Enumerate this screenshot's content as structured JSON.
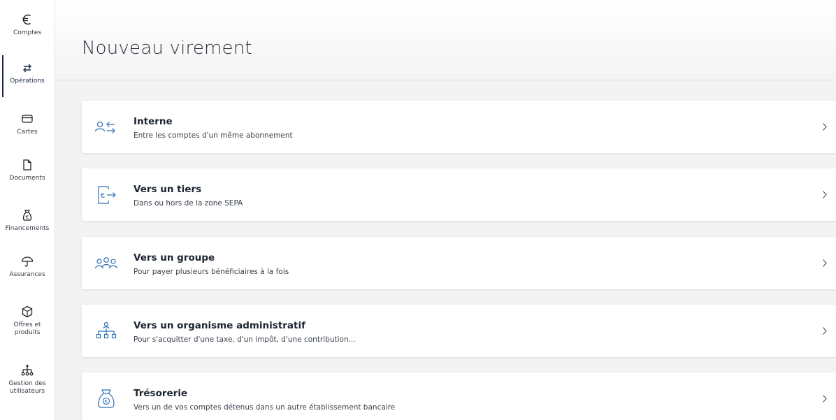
{
  "sidebar": {
    "items": [
      {
        "label": "Comptes",
        "icon": "euro-icon"
      },
      {
        "label": "Opérations",
        "icon": "transfer-arrows-icon",
        "active": true
      },
      {
        "label": "Cartes",
        "icon": "card-icon"
      },
      {
        "label": "Documents",
        "icon": "document-icon"
      },
      {
        "label": "Financements",
        "icon": "money-bag-icon"
      },
      {
        "label": "Assurances",
        "icon": "umbrella-icon"
      },
      {
        "label": "Offres et\nproduits",
        "icon": "box-icon"
      },
      {
        "label": "Gestion des\nutilisateurs",
        "icon": "org-chart-icon"
      }
    ]
  },
  "header": {
    "title": "Nouveau virement"
  },
  "options": [
    {
      "title": "Interne",
      "subtitle": "Entre les comptes d'un même abonnement",
      "icon": "internal-transfer-icon"
    },
    {
      "title": "Vers un tiers",
      "subtitle": "Dans ou hors de la zone SEPA",
      "icon": "third-party-transfer-icon"
    },
    {
      "title": "Vers un groupe",
      "subtitle": "Pour payer plusieurs bénéficiaires à la fois",
      "icon": "group-icon"
    },
    {
      "title": "Vers un organisme administratif",
      "subtitle": "Pour s'acquitter d'une taxe, d'un impôt, d'une contribution...",
      "icon": "organization-icon"
    },
    {
      "title": "Trésorerie",
      "subtitle": "Vers un de vos comptes détenus dans un autre établissement bancaire",
      "icon": "treasury-bag-icon"
    }
  ],
  "colors": {
    "accent": "#1b2a4a",
    "icon_blue": "#2f6fb3",
    "background": "#f3f3f4"
  }
}
